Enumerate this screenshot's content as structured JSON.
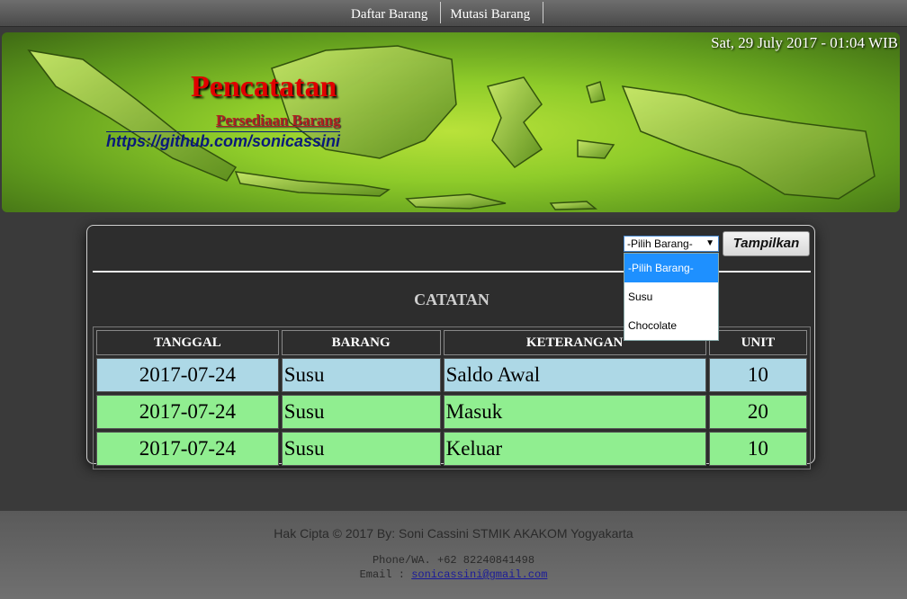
{
  "nav": {
    "items": [
      {
        "label": "Daftar Barang"
      },
      {
        "label": "Mutasi Barang"
      }
    ]
  },
  "banner": {
    "datetime": "Sat, 29 July 2017 - 01:04 WIB",
    "title": "Pencatatan",
    "subtitle": "Persediaan Barang",
    "link": "https://github.com/sonicassini"
  },
  "filter": {
    "select_value": "-Pilih Barang-",
    "options": [
      "-Pilih Barang-",
      "Susu",
      "Chocolate"
    ],
    "button_label": "Tampilkan"
  },
  "section_title": "CATATAN",
  "table": {
    "headers": [
      "TANGGAL",
      "BARANG",
      "KETERANGAN",
      "UNIT"
    ],
    "rows": [
      {
        "tanggal": "2017-07-24",
        "barang": "Susu",
        "keterangan": "Saldo Awal",
        "unit": "10"
      },
      {
        "tanggal": "2017-07-24",
        "barang": "Susu",
        "keterangan": "Masuk",
        "unit": "20"
      },
      {
        "tanggal": "2017-07-24",
        "barang": "Susu",
        "keterangan": "Keluar",
        "unit": "10"
      }
    ]
  },
  "footer": {
    "copyright": "Hak Cipta © 2017 By: Soni Cassini STMIK AKAKOM Yogyakarta",
    "phone": "Phone/WA. +62 82240841498",
    "email_label": "Email : ",
    "email": "sonicassini@gmail.com"
  }
}
